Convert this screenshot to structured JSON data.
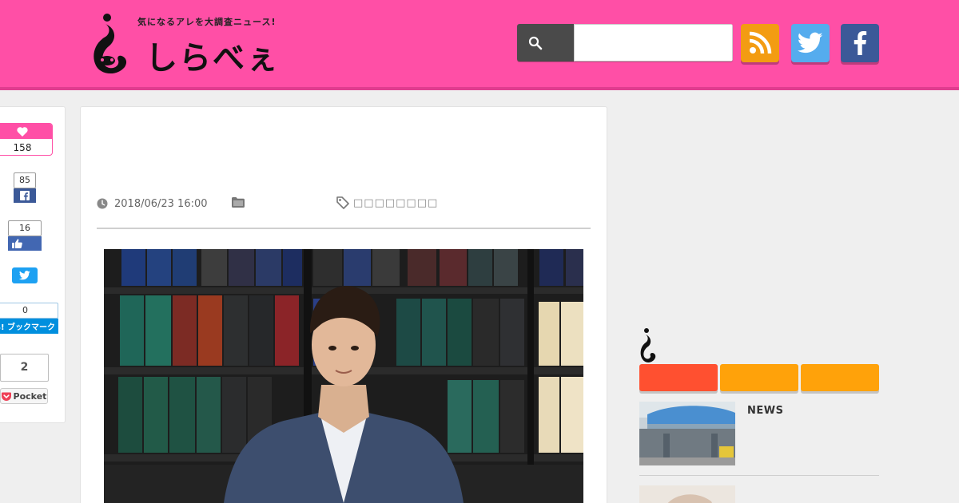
{
  "header": {
    "tagline": "気になるアレを大調査ニュース!",
    "logo_text": "しらべぇ",
    "search_placeholder": "",
    "search_value": ""
  },
  "colors": {
    "header_bg": "#ff4fa6",
    "rss": "#f39c12",
    "twitter": "#55acee",
    "facebook": "#3b5998",
    "tab_active": "#ff5030",
    "tab": "#ffa20a"
  },
  "share": {
    "like_count": "158",
    "facebook_share_count": "85",
    "facebook_like_count": "16",
    "hatena_count": "0",
    "hatena_label": "B! ブックマーク",
    "pocket_count": "2",
    "pocket_label": "Pocket"
  },
  "article": {
    "date": "2018/06/23 16:00",
    "tags_text": "□□□□□□□□"
  },
  "sidebar": {
    "news_items": [
      {
        "category": "NEWS"
      }
    ]
  },
  "icons": [
    "search-icon",
    "rss-icon",
    "twitter-icon",
    "facebook-icon",
    "heart-icon",
    "clock-icon",
    "folder-icon",
    "tag-icon",
    "pocket-icon",
    "thumbs-up-icon"
  ]
}
